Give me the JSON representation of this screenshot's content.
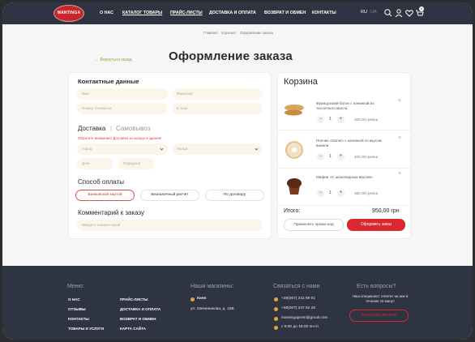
{
  "brand": {
    "logo_text": "MANTINGA",
    "accent": "#d9282e",
    "header_bg": "#2e3441"
  },
  "nav": [
    {
      "label": "О НАС"
    },
    {
      "label": "КАТАЛОГ ТОВАРЫ"
    },
    {
      "label": "ПРАЙС-ЛИСТЫ"
    },
    {
      "label": "ДОСТАВКА И ОПЛАТА"
    },
    {
      "label": "ВОЗВРАТ И ОБМЕН"
    },
    {
      "label": "КОНТАКТЫ"
    }
  ],
  "lang": {
    "ru": "RU",
    "ua": "UA"
  },
  "header_icons": [
    "search-icon",
    "user-icon",
    "heart-icon",
    "cart-icon"
  ],
  "cart_count": "0",
  "breadcrumb": [
    "Главная",
    "Корзина",
    "Оформление заказа"
  ],
  "back_link": "Вернуться назад",
  "page_title": "Оформление заказа",
  "contact": {
    "title": "Контактные данные",
    "name_placeholder": "Имя",
    "surname_placeholder": "Фамилия",
    "phone_placeholder": "Номер телефона",
    "email_placeholder": "E-mail"
  },
  "delivery": {
    "title": "Доставка",
    "pickup": "Самовывоз",
    "warning": "Обратите внимание! Доставка за кольцо в здания!",
    "city_placeholder": "Город",
    "street_placeholder": "Улица",
    "house_placeholder": "Дом",
    "apt_placeholder": "Парадное"
  },
  "payment": {
    "title": "Способ оплаты",
    "options": [
      "Банковской картой",
      "Безналичный расчёт",
      "По договору"
    ]
  },
  "comment": {
    "title": "Комментарий к заказу",
    "placeholder": "Введите комментарий"
  },
  "cart": {
    "title": "Корзина",
    "items": [
      {
        "name": "Французский батон с начинкой из чесночного масла",
        "qty": "1",
        "price": "200,00 грн/кш"
      },
      {
        "name": "Пончик «Donut» с начинкой со вкусом ванили",
        "qty": "1",
        "price": "400,00 грн/кш"
      },
      {
        "name": "Мафин «С шоколадным вкусом»",
        "qty": "1",
        "price": "350,00 грн/кш"
      }
    ],
    "total_label": "Итого:",
    "total_value": "950,00 грн",
    "promo_button": "Применить промо-код",
    "order_button": "Оформить заказ"
  },
  "footer": {
    "menu_title": "Меню:",
    "menu_col1": [
      "О НАС",
      "ОТЗЫВЫ",
      "КОНТАКТЫ",
      "ТОВАРЫ И УСЛУГИ"
    ],
    "menu_col2": [
      "ПРАЙС-ЛИСТЫ",
      "ДОСТАВКА И ОПЛАТА",
      "ВОЗВРАТ И ОБМЕН",
      "КАРТА САЙТА"
    ],
    "shops_title": "Наши магазины:",
    "city": "Киев",
    "address": "ул. Овчинниковa, д. 18В",
    "contact_title": "Связаться с нами",
    "phones": [
      "+38(067) 341 89 01",
      "+38(067) 247 62 26"
    ],
    "email": "mantingaprom@gmail.com",
    "hours": "с 9:00 до 18:00 пн-пт",
    "questions_title": "Есть вопросы?",
    "questions_text": "Наш специалист ответит на них в течение 15 минут",
    "callback_button": "ЗАКАЗАТЬ ЗВОНОК"
  }
}
